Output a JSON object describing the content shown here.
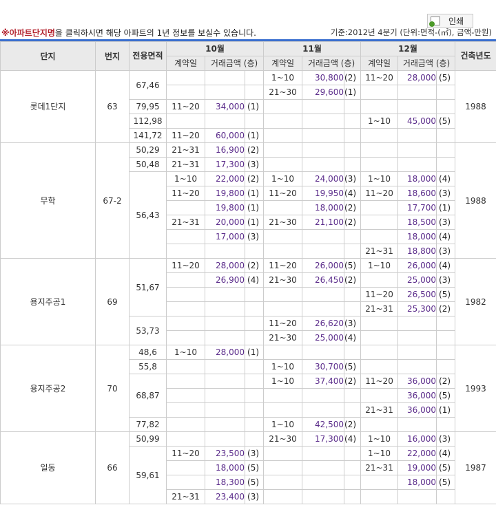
{
  "print_label": "인쇄",
  "notice": {
    "mark": "※아파트단지명",
    "text": "을 클릭하시면 해당 아파트의 1년 정보를 보실수 있습니다.",
    "standard": "기준:2012년 4분기   (단위:면적-(㎡), 금액-만원)"
  },
  "header": {
    "complex": "단지",
    "lot": "번지",
    "area": "전용면적",
    "m10": "10월",
    "m11": "11월",
    "m12": "12월",
    "year": "건축년도",
    "date": "계약일",
    "amount": "거래금액 (층)"
  },
  "rows": [
    [
      "롯데1단지",
      "63",
      "67,46",
      "",
      "",
      "",
      "1~10",
      "30,800",
      "(2)",
      "11~20",
      "28,000",
      "(5)",
      "1988"
    ],
    [
      "",
      "",
      "",
      "",
      "",
      "",
      "21~30",
      "29,600",
      "(1)",
      "",
      "",
      "",
      ""
    ],
    [
      "",
      "",
      "79,95",
      "11~20",
      "34,000",
      "(1)",
      "",
      "",
      "",
      "",
      "",
      "",
      ""
    ],
    [
      "",
      "",
      "112,98",
      "",
      "",
      "",
      "",
      "",
      "",
      "1~10",
      "45,000",
      "(5)",
      ""
    ],
    [
      "",
      "",
      "141,72",
      "11~20",
      "60,000",
      "(1)",
      "",
      "",
      "",
      "",
      "",
      "",
      ""
    ],
    [
      "무학",
      "67-2",
      "50,29",
      "21~31",
      "16,900",
      "(2)",
      "",
      "",
      "",
      "",
      "",
      "",
      "1988"
    ],
    [
      "",
      "",
      "50,48",
      "21~31",
      "17,300",
      "(3)",
      "",
      "",
      "",
      "",
      "",
      "",
      ""
    ],
    [
      "",
      "",
      "56,43",
      "1~10",
      "22,000",
      "(2)",
      "1~10",
      "24,000",
      "(3)",
      "1~10",
      "18,000",
      "(4)",
      ""
    ],
    [
      "",
      "",
      "",
      "11~20",
      "19,800",
      "(1)",
      "11~20",
      "19,950",
      "(4)",
      "11~20",
      "18,600",
      "(3)",
      ""
    ],
    [
      "",
      "",
      "",
      "",
      "19,800",
      "(1)",
      "",
      "18,000",
      "(2)",
      "",
      "17,700",
      "(1)",
      ""
    ],
    [
      "",
      "",
      "",
      "21~31",
      "20,000",
      "(1)",
      "21~30",
      "21,100",
      "(2)",
      "",
      "18,500",
      "(3)",
      ""
    ],
    [
      "",
      "",
      "",
      "",
      "17,000",
      "(3)",
      "",
      "",
      "",
      "",
      "18,000",
      "(4)",
      ""
    ],
    [
      "",
      "",
      "",
      "",
      "",
      "",
      "",
      "",
      "",
      "21~31",
      "18,800",
      "(3)",
      ""
    ],
    [
      "용지주공1",
      "69",
      "51,67",
      "11~20",
      "28,000",
      "(2)",
      "11~20",
      "26,000",
      "(5)",
      "1~10",
      "26,000",
      "(4)",
      "1982"
    ],
    [
      "",
      "",
      "",
      "",
      "26,900",
      "(4)",
      "21~30",
      "26,450",
      "(2)",
      "",
      "25,000",
      "(3)",
      ""
    ],
    [
      "",
      "",
      "",
      "",
      "",
      "",
      "",
      "",
      "",
      "11~20",
      "26,500",
      "(5)",
      ""
    ],
    [
      "",
      "",
      "",
      "",
      "",
      "",
      "",
      "",
      "",
      "21~31",
      "25,300",
      "(2)",
      ""
    ],
    [
      "",
      "",
      "53,73",
      "",
      "",
      "",
      "11~20",
      "26,620",
      "(3)",
      "",
      "",
      "",
      ""
    ],
    [
      "",
      "",
      "",
      "",
      "",
      "",
      "21~30",
      "25,000",
      "(4)",
      "",
      "",
      "",
      ""
    ],
    [
      "용지주공2",
      "70",
      "48,6",
      "1~10",
      "28,000",
      "(1)",
      "",
      "",
      "",
      "",
      "",
      "",
      "1993"
    ],
    [
      "",
      "",
      "55,8",
      "",
      "",
      "",
      "1~10",
      "30,700",
      "(5)",
      "",
      "",
      "",
      ""
    ],
    [
      "",
      "",
      "68,87",
      "",
      "",
      "",
      "1~10",
      "37,400",
      "(2)",
      "11~20",
      "36,000",
      "(2)",
      ""
    ],
    [
      "",
      "",
      "",
      "",
      "",
      "",
      "",
      "",
      "",
      "",
      "36,000",
      "(5)",
      ""
    ],
    [
      "",
      "",
      "",
      "",
      "",
      "",
      "",
      "",
      "",
      "21~31",
      "36,000",
      "(1)",
      ""
    ],
    [
      "",
      "",
      "77,82",
      "",
      "",
      "",
      "1~10",
      "42,500",
      "(2)",
      "",
      "",
      "",
      ""
    ],
    [
      "일동",
      "66",
      "50,99",
      "",
      "",
      "",
      "21~30",
      "17,300",
      "(4)",
      "1~10",
      "16,000",
      "(3)",
      "1987"
    ],
    [
      "",
      "",
      "59,61",
      "11~20",
      "23,500",
      "(3)",
      "",
      "",
      "",
      "1~10",
      "22,000",
      "(4)",
      ""
    ],
    [
      "",
      "",
      "",
      "",
      "18,000",
      "(5)",
      "",
      "",
      "",
      "21~31",
      "19,000",
      "(5)",
      ""
    ],
    [
      "",
      "",
      "",
      "",
      "18,300",
      "(5)",
      "",
      "",
      "",
      "",
      "18,000",
      "(5)",
      ""
    ],
    [
      "",
      "",
      "",
      "21~31",
      "23,400",
      "(3)",
      "",
      "",
      "",
      "",
      "",
      "",
      ""
    ]
  ]
}
